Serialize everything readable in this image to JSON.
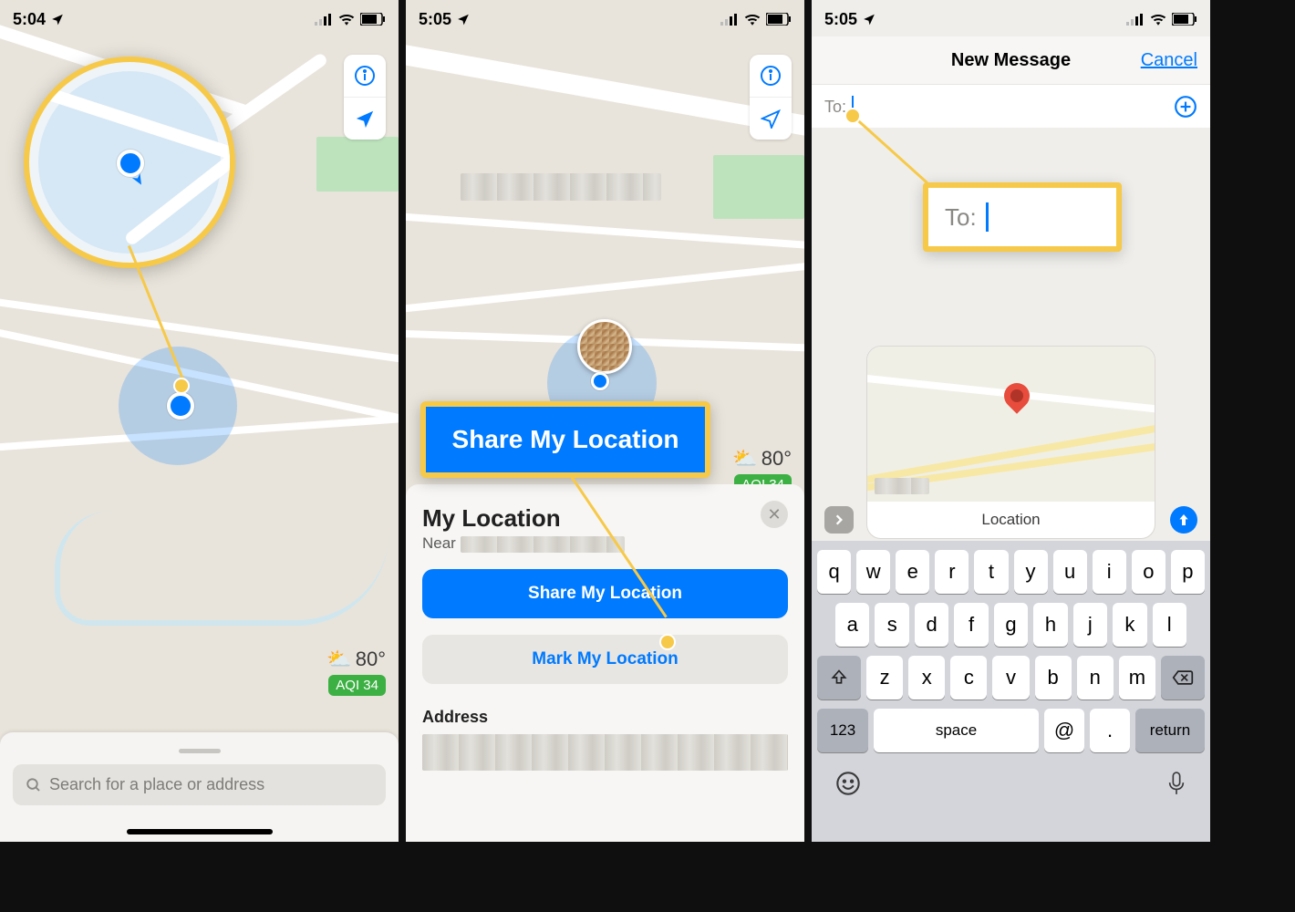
{
  "panel1": {
    "time": "5:04",
    "search_placeholder": "Search for a place or address",
    "weather": {
      "temp": "80°",
      "aqi": "AQI 34"
    },
    "icons": {
      "info": "info-icon",
      "locate": "locate-arrow-icon"
    }
  },
  "panel2": {
    "time": "5:05",
    "weather": {
      "temp": "80°",
      "aqi": "AQI 34"
    },
    "title": "My Location",
    "near": "Near",
    "share": "Share My Location",
    "mark": "Mark My Location",
    "address": "Address",
    "highlight": "Share My Location"
  },
  "panel3": {
    "time": "5:05",
    "title": "New Message",
    "cancel": "Cancel",
    "to": "To:",
    "attachment": "Location",
    "highlight_to": "To:",
    "kb": {
      "r1": [
        "q",
        "w",
        "e",
        "r",
        "t",
        "y",
        "u",
        "i",
        "o",
        "p"
      ],
      "r2": [
        "a",
        "s",
        "d",
        "f",
        "g",
        "h",
        "j",
        "k",
        "l"
      ],
      "r3": [
        "z",
        "x",
        "c",
        "v",
        "b",
        "n",
        "m"
      ],
      "r4": {
        "num": "123",
        "space": "space",
        "at": "@",
        "dot": ".",
        "ret": "return"
      }
    }
  }
}
